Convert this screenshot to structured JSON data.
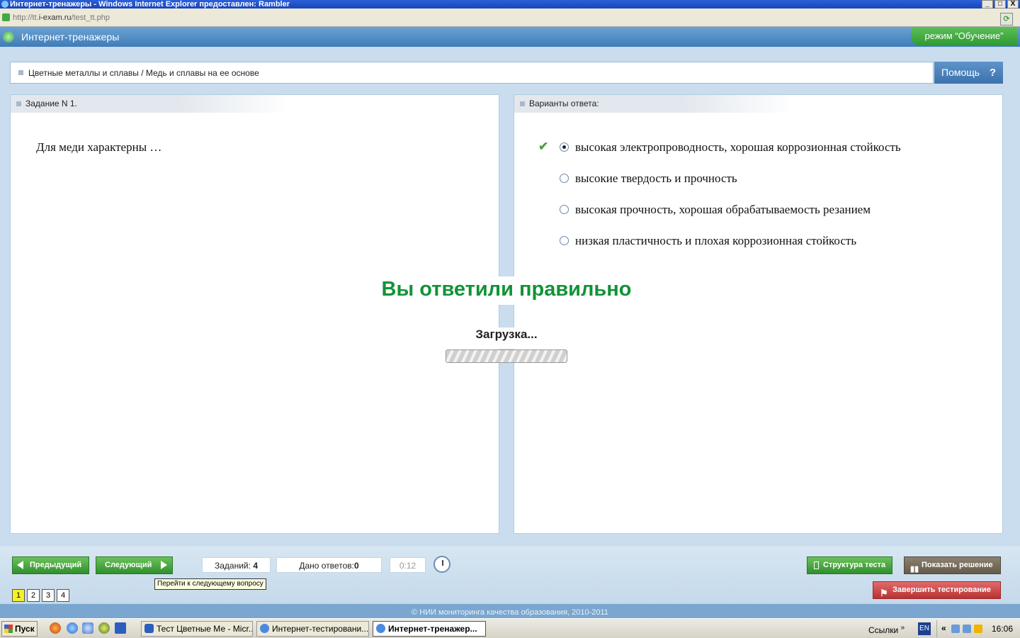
{
  "window": {
    "title": "Интернет-тренажеры - Windows Internet Explorer предоставлен: Rambler",
    "url_prefix": "http://tt.",
    "url_domain": "i-exam.ru",
    "url_path": "/test_tt.php",
    "buttons": [
      "_",
      "□",
      "X"
    ]
  },
  "header": {
    "app_title": "Интернет-тренажеры",
    "mode": "режим “Обучение”"
  },
  "breadcrumb": {
    "text": "Цветные металлы и сплавы / Медь и сплавы на ее основе",
    "help_label": "Помощь",
    "help_icon": "?"
  },
  "task": {
    "header": "Задание N 1.",
    "question": "Для меди характерны …"
  },
  "answers": {
    "header": "Варианты ответа:",
    "items": [
      {
        "text": "высокая электропроводность, хорошая коррозионная стойкость",
        "selected": true,
        "correct": true
      },
      {
        "text": "высокие твердость и прочность",
        "selected": false
      },
      {
        "text": "высокая прочность, хорошая обрабатываемость резанием",
        "selected": false
      },
      {
        "text": "низкая пластичность и плохая коррозионная стойкость",
        "selected": false
      }
    ],
    "check_icon": "✔"
  },
  "overlay": {
    "result": "Вы ответили правильно",
    "loading": "Загрузка..."
  },
  "nav": {
    "prev_label": "Предыдущий",
    "next_label": "Следующий",
    "tasks_label": "Заданий:",
    "tasks_count": "4",
    "answers_label": "Дано ответов:",
    "answers_count": "0",
    "timer": "0:12",
    "tooltip": "Перейти к следующему вопросу",
    "pages": [
      "1",
      "2",
      "3",
      "4"
    ],
    "structure_label": "Структура теста",
    "solution_label": "Показать решение",
    "finish_label": "Завершить тестирование"
  },
  "footer": {
    "copyright": "© НИИ мониторинга качества образования, 2010-2011"
  },
  "taskbar": {
    "start": "Пуск",
    "tasks": [
      "Тест Цветные Ме - Micr...",
      "Интернет-тестировани...",
      "Интернет-тренажер..."
    ],
    "links": "Ссылки",
    "links_chevron": "»",
    "lang": "EN",
    "tray_chevron": "«",
    "time": "16:06"
  },
  "colors": {
    "accent_green": "#129237",
    "header_blue": "#3f7cb8",
    "finish_red": "#b83232"
  }
}
